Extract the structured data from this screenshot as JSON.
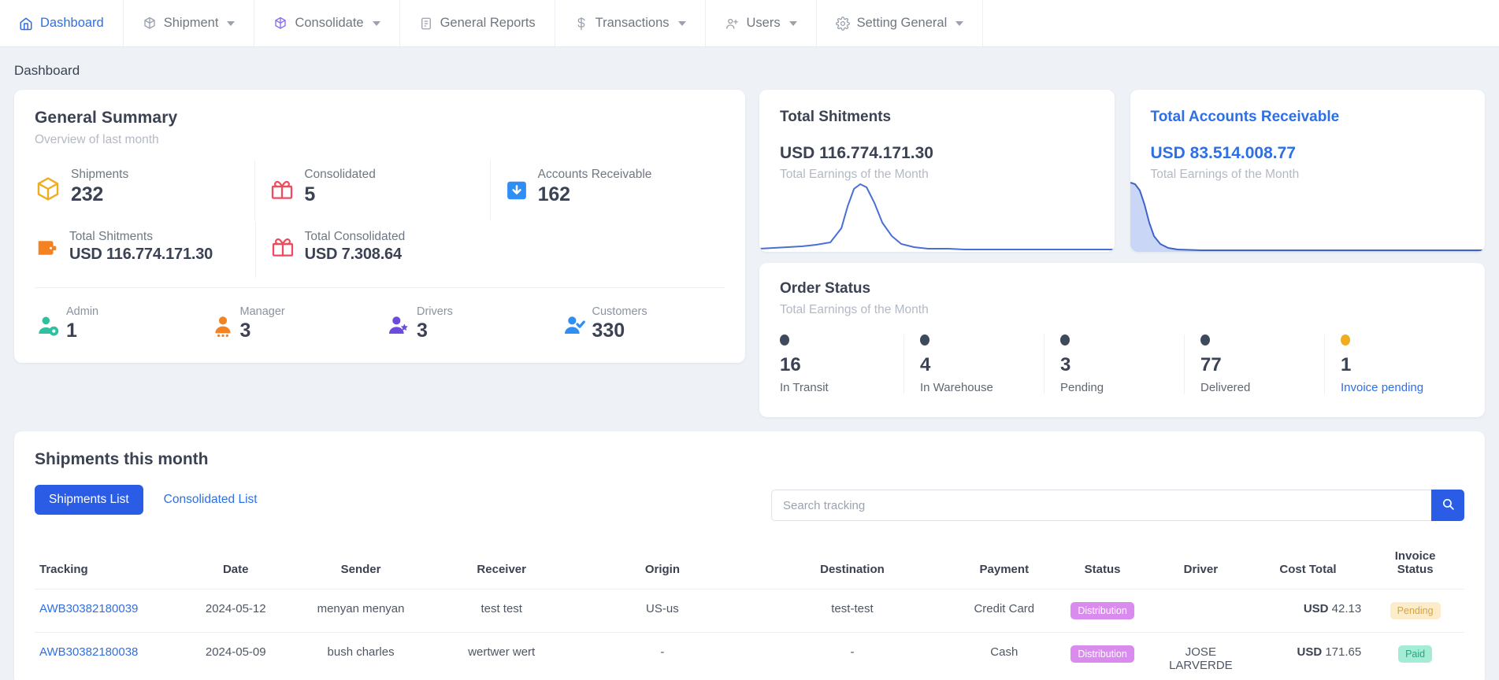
{
  "navbar": {
    "items": [
      {
        "label": "Dashboard",
        "icon": "home-icon",
        "active": true,
        "caret": false
      },
      {
        "label": "Shipment",
        "icon": "box-icon",
        "active": false,
        "caret": true
      },
      {
        "label": "Consolidate",
        "icon": "box-purple-icon",
        "active": false,
        "caret": true
      },
      {
        "label": "General Reports",
        "icon": "document-icon",
        "active": false,
        "caret": false
      },
      {
        "label": "Transactions",
        "icon": "dollar-icon",
        "active": false,
        "caret": true
      },
      {
        "label": "Users",
        "icon": "user-plus-icon",
        "active": false,
        "caret": true
      },
      {
        "label": "Setting General",
        "icon": "gear-icon",
        "active": false,
        "caret": true
      }
    ]
  },
  "page": {
    "title": "Dashboard"
  },
  "general_summary": {
    "title": "General Summary",
    "subtitle": "Overview of last month",
    "stats_row1": [
      {
        "label": "Shipments",
        "value": "232",
        "icon": "package-icon",
        "color": "#f0ad1f"
      },
      {
        "label": "Consolidated",
        "value": "5",
        "icon": "gift-icon",
        "color": "#ef4a5e"
      },
      {
        "label": "Accounts Receivable",
        "value": "162",
        "icon": "inbox-down-icon",
        "color": "#2f8ef4"
      }
    ],
    "stats_row2": [
      {
        "label": "Total Shitments",
        "value": "USD 116.774.171.30",
        "icon": "wallet-icon",
        "color": "#f58220"
      },
      {
        "label": "Total Consolidated",
        "value": "USD 7.308.64",
        "icon": "gift-icon",
        "color": "#ef4a5e"
      }
    ],
    "users": [
      {
        "label": "Admin",
        "value": "1",
        "icon": "user-gear-icon",
        "color": "#2fc0a0"
      },
      {
        "label": "Manager",
        "value": "3",
        "icon": "user-group-icon",
        "color": "#f58220"
      },
      {
        "label": "Drivers",
        "value": "3",
        "icon": "user-star-icon",
        "color": "#6c4ce0"
      },
      {
        "label": "Customers",
        "value": "330",
        "icon": "user-check-icon",
        "color": "#2f8ef4"
      }
    ]
  },
  "total_shipments_card": {
    "title": "Total Shitments",
    "amount": "USD 116.774.171.30",
    "caption": "Total Earnings of the Month",
    "accent": "#3b4252"
  },
  "total_receivable_card": {
    "title": "Total Accounts Receivable",
    "amount": "USD 83.514.008.77",
    "caption": "Total Earnings of the Month",
    "accent": "#2f6fe4"
  },
  "order_status": {
    "title": "Order Status",
    "caption": "Total Earnings of the Month",
    "items": [
      {
        "value": "16",
        "label": "In Transit",
        "dot": "#3d4a5c",
        "link": false
      },
      {
        "value": "4",
        "label": "In Warehouse",
        "dot": "#3d4a5c",
        "link": false
      },
      {
        "value": "3",
        "label": "Pending",
        "dot": "#3d4a5c",
        "link": false
      },
      {
        "value": "77",
        "label": "Delivered",
        "dot": "#3d4a5c",
        "link": false
      },
      {
        "value": "1",
        "label": "Invoice pending",
        "dot": "#f0ad1f",
        "link": true
      }
    ]
  },
  "shipments": {
    "title": "Shipments this month",
    "tabs": [
      {
        "label": "Shipments List",
        "active": true
      },
      {
        "label": "Consolidated List",
        "active": false
      }
    ],
    "search": {
      "placeholder": "Search tracking",
      "value": "",
      "icon": "search-icon"
    },
    "columns": [
      "Tracking",
      "Date",
      "Sender",
      "Receiver",
      "Origin",
      "Destination",
      "Payment",
      "Status",
      "Driver",
      "Cost Total",
      "Invoice Status"
    ],
    "rows": [
      {
        "tracking": "AWB30382180039",
        "date": "2024-05-12",
        "sender": "menyan menyan",
        "receiver": "test test",
        "origin": "US-us",
        "destination": "test-test",
        "payment": "Credit Card",
        "status": "Distribution",
        "driver": "",
        "cost_currency": "USD",
        "cost_amount": "42.13",
        "invoice_status": "Pending",
        "invoice_class": "pending"
      },
      {
        "tracking": "AWB30382180038",
        "date": "2024-05-09",
        "sender": "bush charles",
        "receiver": "wertwer wert",
        "origin": "-",
        "destination": "-",
        "payment": "Cash",
        "status": "Distribution",
        "driver": "JOSE LARVERDE",
        "cost_currency": "USD",
        "cost_amount": "171.65",
        "invoice_status": "Paid",
        "invoice_class": "paid"
      }
    ]
  },
  "colors": {
    "primary": "#2b5ce6",
    "link": "#2f6fe4",
    "badge_status": "#d98ced",
    "badge_pending_bg": "#fdecc9",
    "badge_paid_bg": "#a5ecd7",
    "page_bg": "#eef2f6"
  }
}
